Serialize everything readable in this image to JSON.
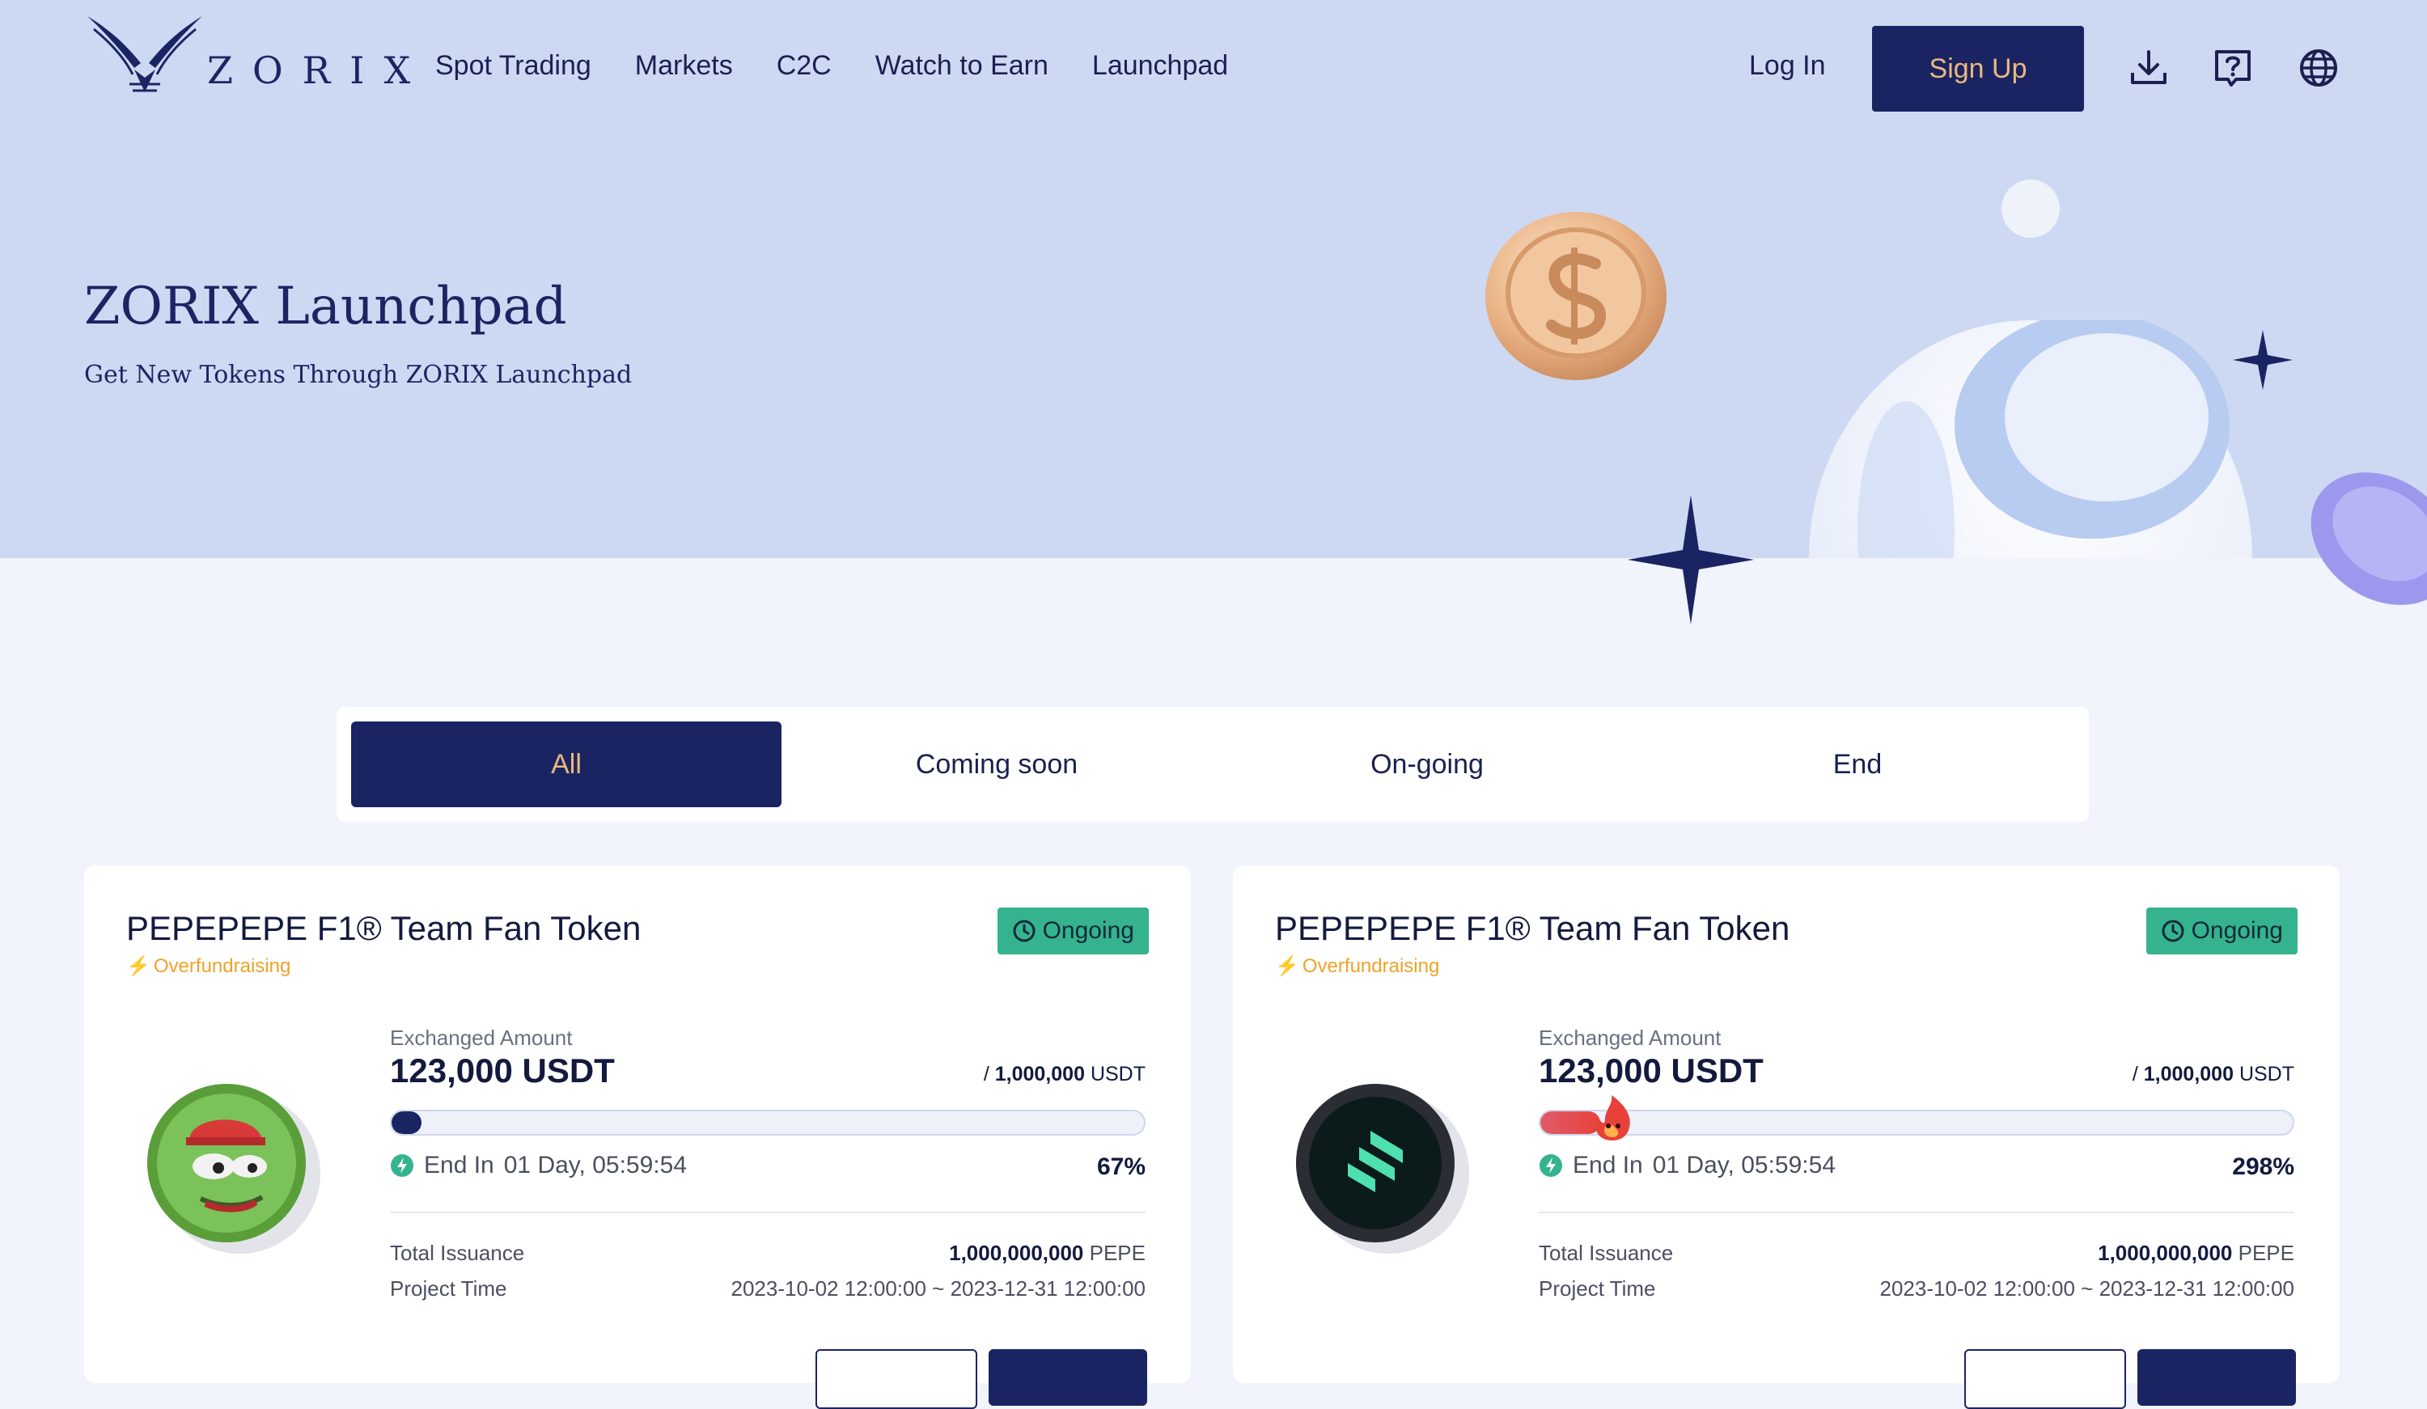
{
  "nav": {
    "logo_text": "ZORIX",
    "links": [
      "Spot Trading",
      "Markets",
      "C2C",
      "Watch to Earn",
      "Launchpad"
    ],
    "login_label": "Log In",
    "signup_label": "Sign Up",
    "icons": [
      "download-icon",
      "help-icon",
      "globe-icon"
    ]
  },
  "hero": {
    "title": "ZORIX Launchpad",
    "subtitle": "Get New Tokens Through ZORIX Launchpad"
  },
  "tabs": [
    "All",
    "Coming soon",
    "On-going",
    "End"
  ],
  "active_tab": "All",
  "cards": [
    {
      "title": "PEPEPEPE F1® Team Fan Token",
      "tag": "Overfundraising",
      "status": "Ongoing",
      "exchanged_label": "Exchanged Amount",
      "exchanged": "123,000 USDT",
      "total_prefix": "/",
      "total_value": "1,000,000",
      "total_unit": "USDT",
      "progress_fraction": 0.04,
      "end_label": "End In",
      "end_value": "01 Day, 05:59:54",
      "percent": "67%",
      "issuance_label": "Total Issuance",
      "issuance_value": "1,000,000,000",
      "issuance_unit": "PEPE",
      "project_time_label": "Project Time",
      "project_time_value": "2023-10-02 12:00:00 ~ 2023-12-31 12:00:00"
    },
    {
      "title": "PEPEPEPE F1® Team Fan Token",
      "tag": "Overfundraising",
      "status": "Ongoing",
      "exchanged_label": "Exchanged Amount",
      "exchanged": "123,000 USDT",
      "total_prefix": "/",
      "total_value": "1,000,000",
      "total_unit": "USDT",
      "progress_fraction": 0.08,
      "end_label": "End In",
      "end_value": "01 Day, 05:59:54",
      "percent": "298%",
      "issuance_label": "Total Issuance",
      "issuance_value": "1,000,000,000",
      "issuance_unit": "PEPE",
      "project_time_label": "Project Time",
      "project_time_value": "2023-10-02 12:00:00 ~ 2023-12-31 12:00:00"
    }
  ],
  "colors": {
    "hero_bg": "#cdd9f2",
    "page_bg": "#f1f4fc",
    "brand": "#1b2462",
    "accent": "#e9b97e",
    "ongoing": "#35b38e",
    "warning": "#f0a22a"
  }
}
